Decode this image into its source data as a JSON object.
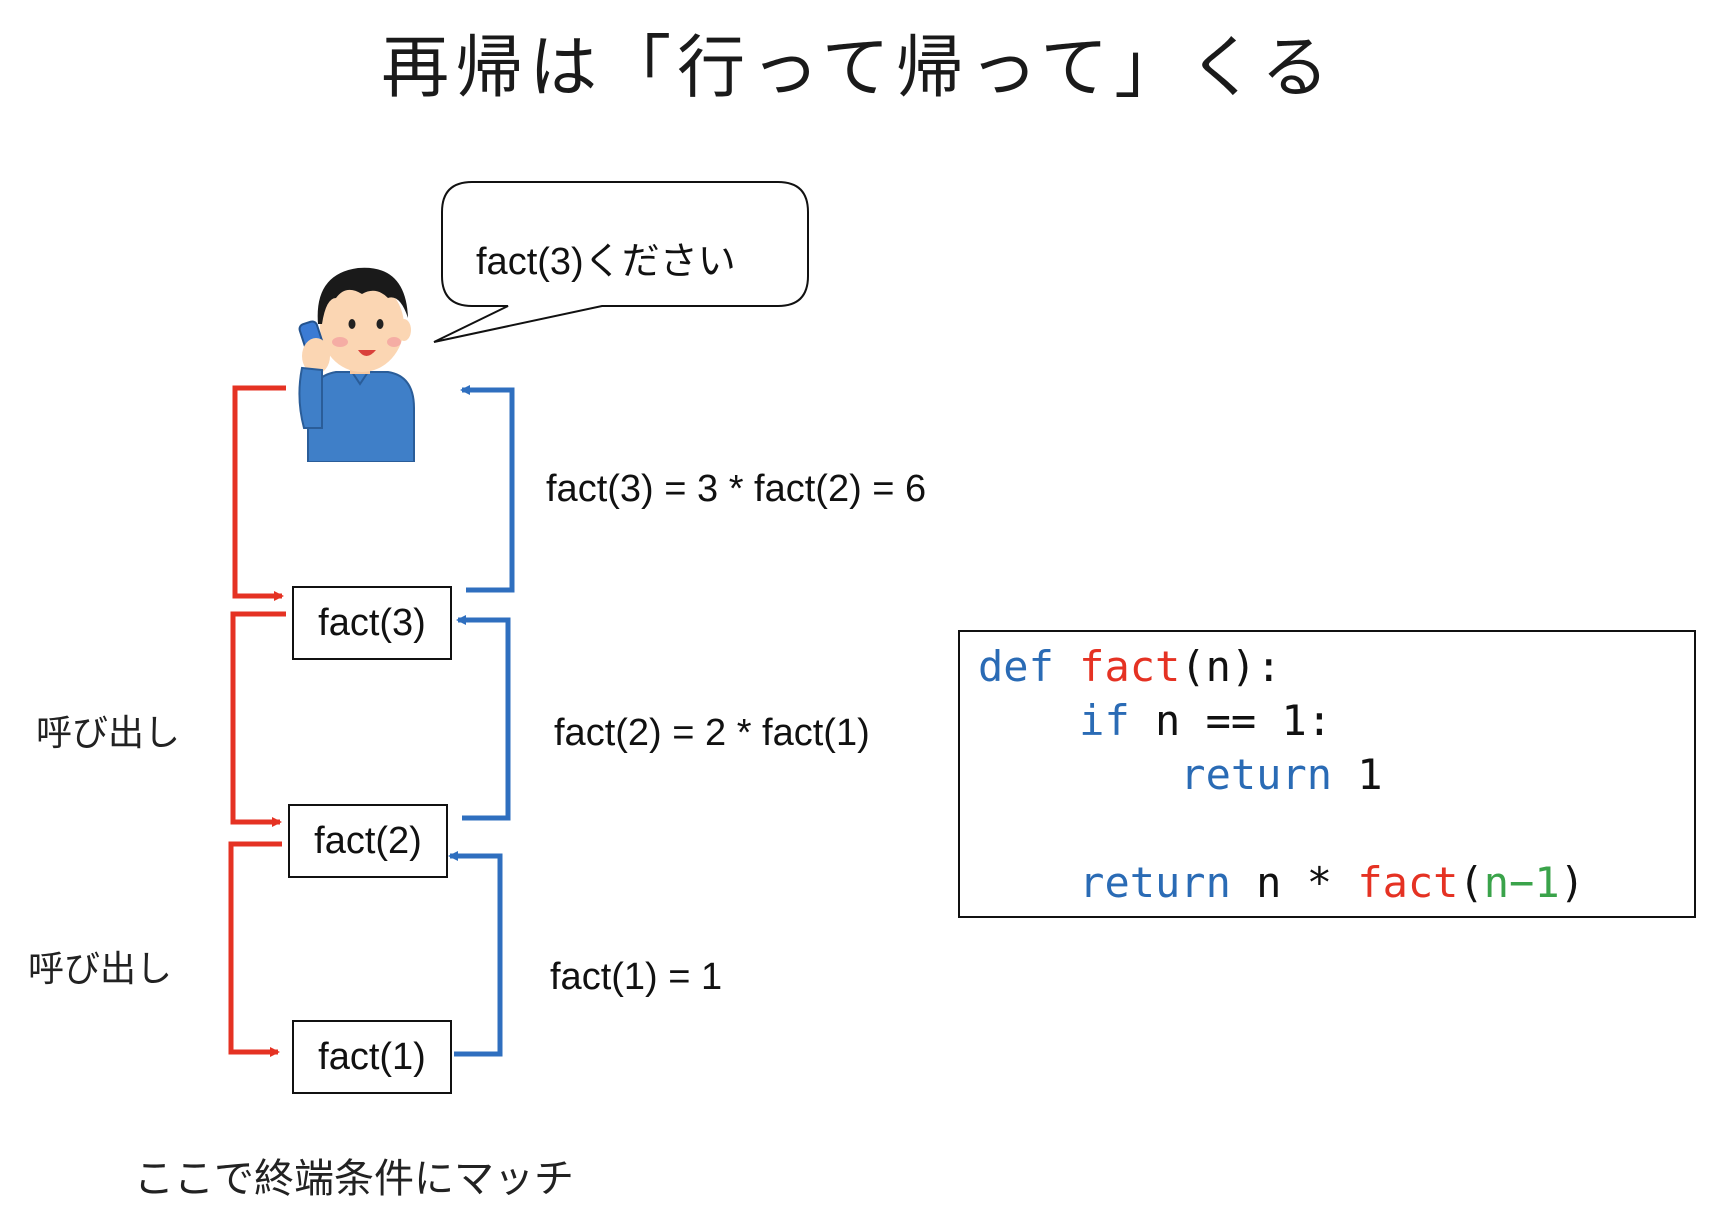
{
  "title": "再帰は「行って帰って」くる",
  "bubble": {
    "text": "fact(3)ください"
  },
  "boxes": [
    {
      "label": "fact(3)"
    },
    {
      "label": "fact(2)"
    },
    {
      "label": "fact(1)"
    }
  ],
  "return_labels": [
    "fact(3) = 3 * fact(2) = 6",
    "fact(2) = 2 * fact(1)",
    "fact(1) = 1"
  ],
  "call_labels": [
    "呼び出し",
    "呼び出し"
  ],
  "base_case_note": "ここで終端条件にマッチ",
  "code": {
    "line1": {
      "def": "def",
      "name": "fact",
      "rest": "(n):"
    },
    "line2": {
      "if": "if",
      "rest": " n == 1:"
    },
    "line3": {
      "return": "return",
      "rest": " 1"
    },
    "line5": {
      "return": "return",
      "mid": " n * ",
      "name": "fact",
      "open": "(",
      "arg": "n−1",
      "close": ")"
    }
  },
  "colors": {
    "call_arrow": "#e53223",
    "return_arrow": "#2f6fbf",
    "keyword": "#2a6bb5",
    "function": "#e53223",
    "argument": "#3aa34a"
  },
  "icons": {
    "person": "person-on-phone-icon"
  }
}
